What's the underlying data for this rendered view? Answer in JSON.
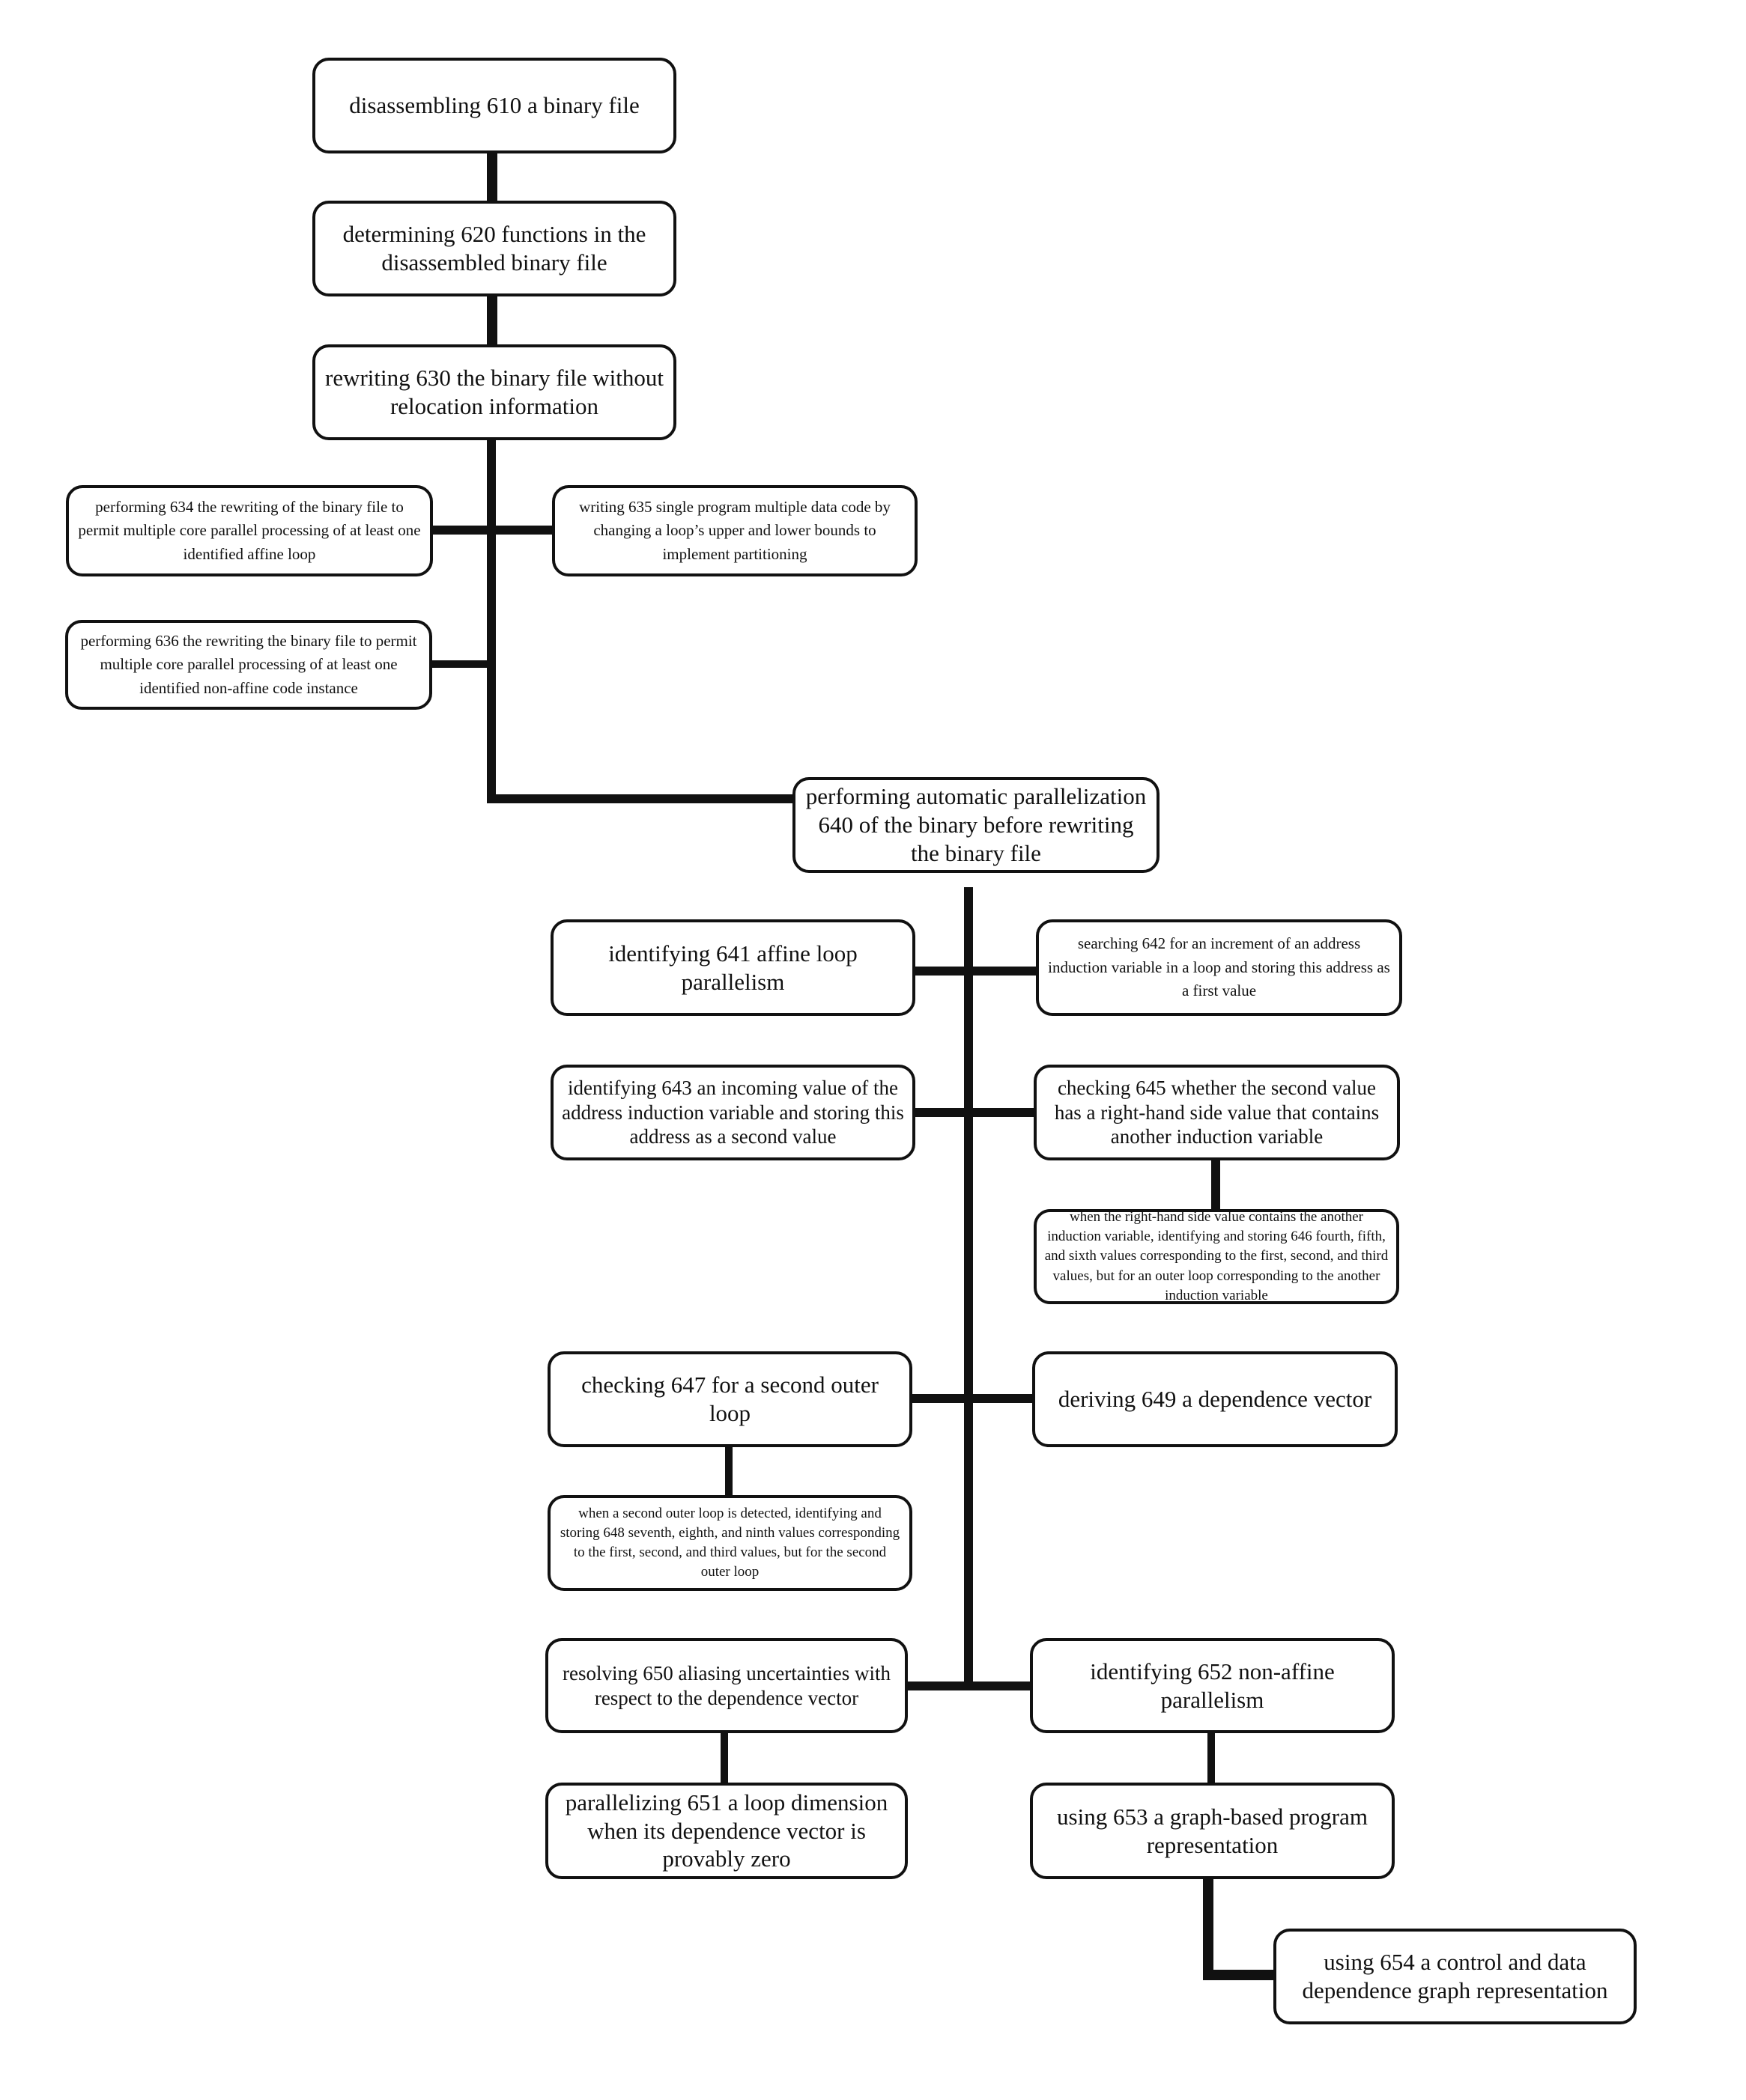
{
  "figure": {
    "nodes": {
      "n610": "disassembling 610  a binary file",
      "n620": "determining 620 functions in the disassembled binary file",
      "n630": "rewriting 630 the binary file without relocation information",
      "n634": "performing 634 the rewriting of the binary file to permit multiple core parallel processing of at least one identified affine loop",
      "n635": "writing 635 single program multiple data code by changing a loop’s upper and lower bounds to implement partitioning",
      "n636": "performing 636 the rewriting the binary file to permit multiple core parallel processing of at least one identified non-affine code instance",
      "n640": "performing automatic parallelization 640 of the binary before rewriting the binary file",
      "n641": "identifying 641 affine loop parallelism",
      "n642": "searching 642 for an increment of an address induction variable in a loop and storing this address as a first value",
      "n643": "identifying 643 an incoming value of the address induction variable and storing this address as a second value",
      "n645": "checking 645 whether the second value has a right-hand side value that contains another induction variable",
      "n646": "when the right-hand side value contains the another induction variable, identifying and storing 646 fourth, fifth, and sixth values corresponding to the first, second, and third values, but for an outer loop corresponding to the another induction variable",
      "n647": "checking 647 for a second outer loop",
      "n648": "when a second outer loop is detected, identifying and storing 648 seventh, eighth, and ninth values corresponding to the first, second, and third values, but for the second outer loop",
      "n649": "deriving 649 a dependence vector",
      "n650": "resolving 650 aliasing uncertainties with respect to the dependence vector",
      "n651": "parallelizing 651 a loop dimension when its dependence vector is provably zero",
      "n652": "identifying 652 non-affine parallelism",
      "n653": "using 653 a graph-based program representation",
      "n654": "using 654 a control and data dependence graph representation"
    },
    "edges": [
      [
        "n610",
        "n620"
      ],
      [
        "n620",
        "n630"
      ],
      [
        "n630",
        "n634"
      ],
      [
        "n630",
        "n635"
      ],
      [
        "n630",
        "n636"
      ],
      [
        "n630",
        "n640"
      ],
      [
        "n640",
        "n641"
      ],
      [
        "n640",
        "n642"
      ],
      [
        "n640",
        "n643"
      ],
      [
        "n640",
        "n645"
      ],
      [
        "n645",
        "n646"
      ],
      [
        "n640",
        "n647"
      ],
      [
        "n647",
        "n648"
      ],
      [
        "n640",
        "n649"
      ],
      [
        "n640",
        "n650"
      ],
      [
        "n650",
        "n651"
      ],
      [
        "n640",
        "n652"
      ],
      [
        "n652",
        "n653"
      ],
      [
        "n653",
        "n654"
      ]
    ],
    "colors": {
      "ink": "#111111",
      "background": "#ffffff"
    }
  }
}
